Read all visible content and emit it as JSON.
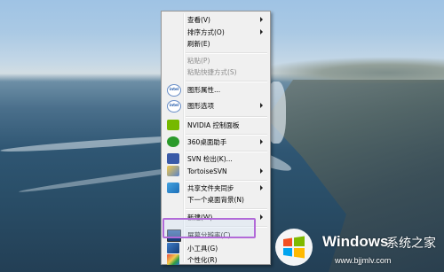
{
  "context_menu": {
    "items": [
      {
        "label": "查看(V)",
        "submenu": true
      },
      {
        "label": "排序方式(O)",
        "submenu": true
      },
      {
        "label": "刷新(E)"
      },
      {
        "label": "粘贴(P)",
        "disabled": true
      },
      {
        "label": "粘贴快捷方式(S)",
        "disabled": true
      },
      {
        "label": "图形属性...",
        "icon": "intel-icon"
      },
      {
        "label": "图形选项",
        "icon": "intel-icon",
        "submenu": true
      },
      {
        "label": "NVIDIA 控制面板",
        "icon": "nvidia-icon"
      },
      {
        "label": "360桌面助手",
        "icon": "360-icon",
        "submenu": true
      },
      {
        "label": "SVN 检出(K)...",
        "icon": "svn-icon"
      },
      {
        "label": "TortoiseSVN",
        "icon": "tortoisesvn-icon",
        "submenu": true
      },
      {
        "label": "共享文件夹同步",
        "icon": "share-sync-icon",
        "submenu": true
      },
      {
        "label": "下一个桌面背景(N)"
      },
      {
        "label": "新建(W)",
        "submenu": true
      },
      {
        "label": "屏幕分辨率(C)",
        "icon": "screen-resolution-icon",
        "highlighted": true
      },
      {
        "label": "小工具(G)",
        "icon": "gadgets-icon"
      },
      {
        "label": "个性化(R)",
        "icon": "personalize-icon"
      }
    ],
    "intel_icon_text": "intel"
  },
  "watermark": {
    "brand": "Windows",
    "site_name": "系统之家",
    "url": "www.bjjmlv.com"
  },
  "colors": {
    "highlight_border": "#b26ad8",
    "menu_bg": "#f0f0f0"
  }
}
